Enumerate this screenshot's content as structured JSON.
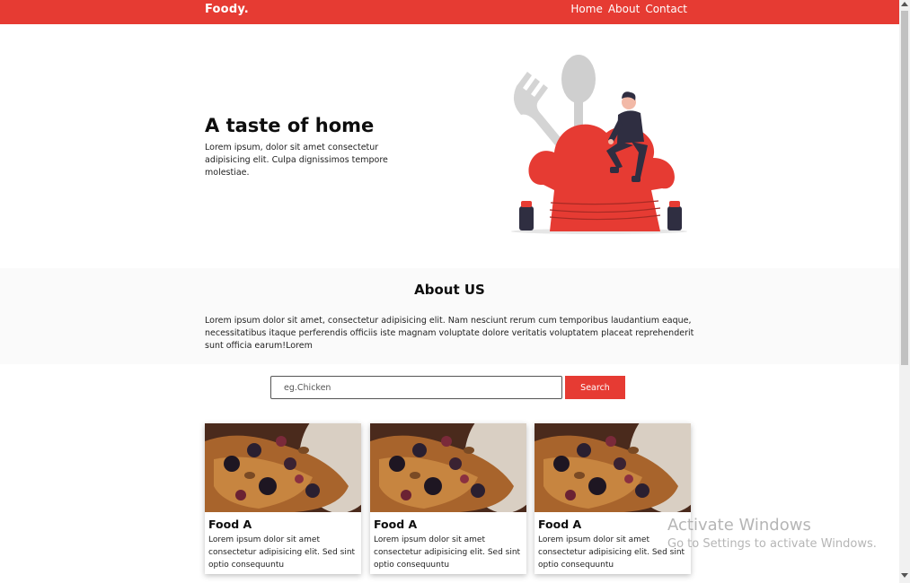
{
  "colors": {
    "accent": "#e63b33",
    "about_bg": "#fafafa",
    "illustration_gray": "#d4d4d4",
    "figure_dark": "#2f2e41"
  },
  "navbar": {
    "brand": "Foody.",
    "links": [
      {
        "label": "Home"
      },
      {
        "label": "About"
      },
      {
        "label": "Contact"
      }
    ]
  },
  "hero": {
    "title": "A taste of home",
    "text": "Lorem ipsum, dolor sit amet consectetur adipisicing elit. Culpa dignissimos tempore molestiae.",
    "illustration": "chef-hat-with-person-and-utensils"
  },
  "about": {
    "title": "About US",
    "text": "Lorem ipsum dolor sit amet, consectetur adipisicing elit. Nam nesciunt rerum cum temporibus laudantium eaque, necessitatibus itaque perferendis officiis iste magnam voluptate dolore veritatis voluptatem placeat reprehenderit sunt officia earum!Lorem"
  },
  "search": {
    "placeholder": "eg.Chicken",
    "value": "",
    "button_label": "Search"
  },
  "cards": [
    {
      "title": "Food A",
      "text": "Lorem ipsum dolor sit amet consectetur adipisicing elit. Sed sint optio consequuntu",
      "image": "crepes-with-berries"
    },
    {
      "title": "Food A",
      "text": "Lorem ipsum dolor sit amet consectetur adipisicing elit. Sed sint optio consequuntu",
      "image": "crepes-with-berries"
    },
    {
      "title": "Food A",
      "text": "Lorem ipsum dolor sit amet consectetur adipisicing elit. Sed sint optio consequuntu",
      "image": "crepes-with-berries"
    }
  ],
  "watermark": {
    "title": "Activate Windows",
    "subtitle": "Go to Settings to activate Windows."
  }
}
